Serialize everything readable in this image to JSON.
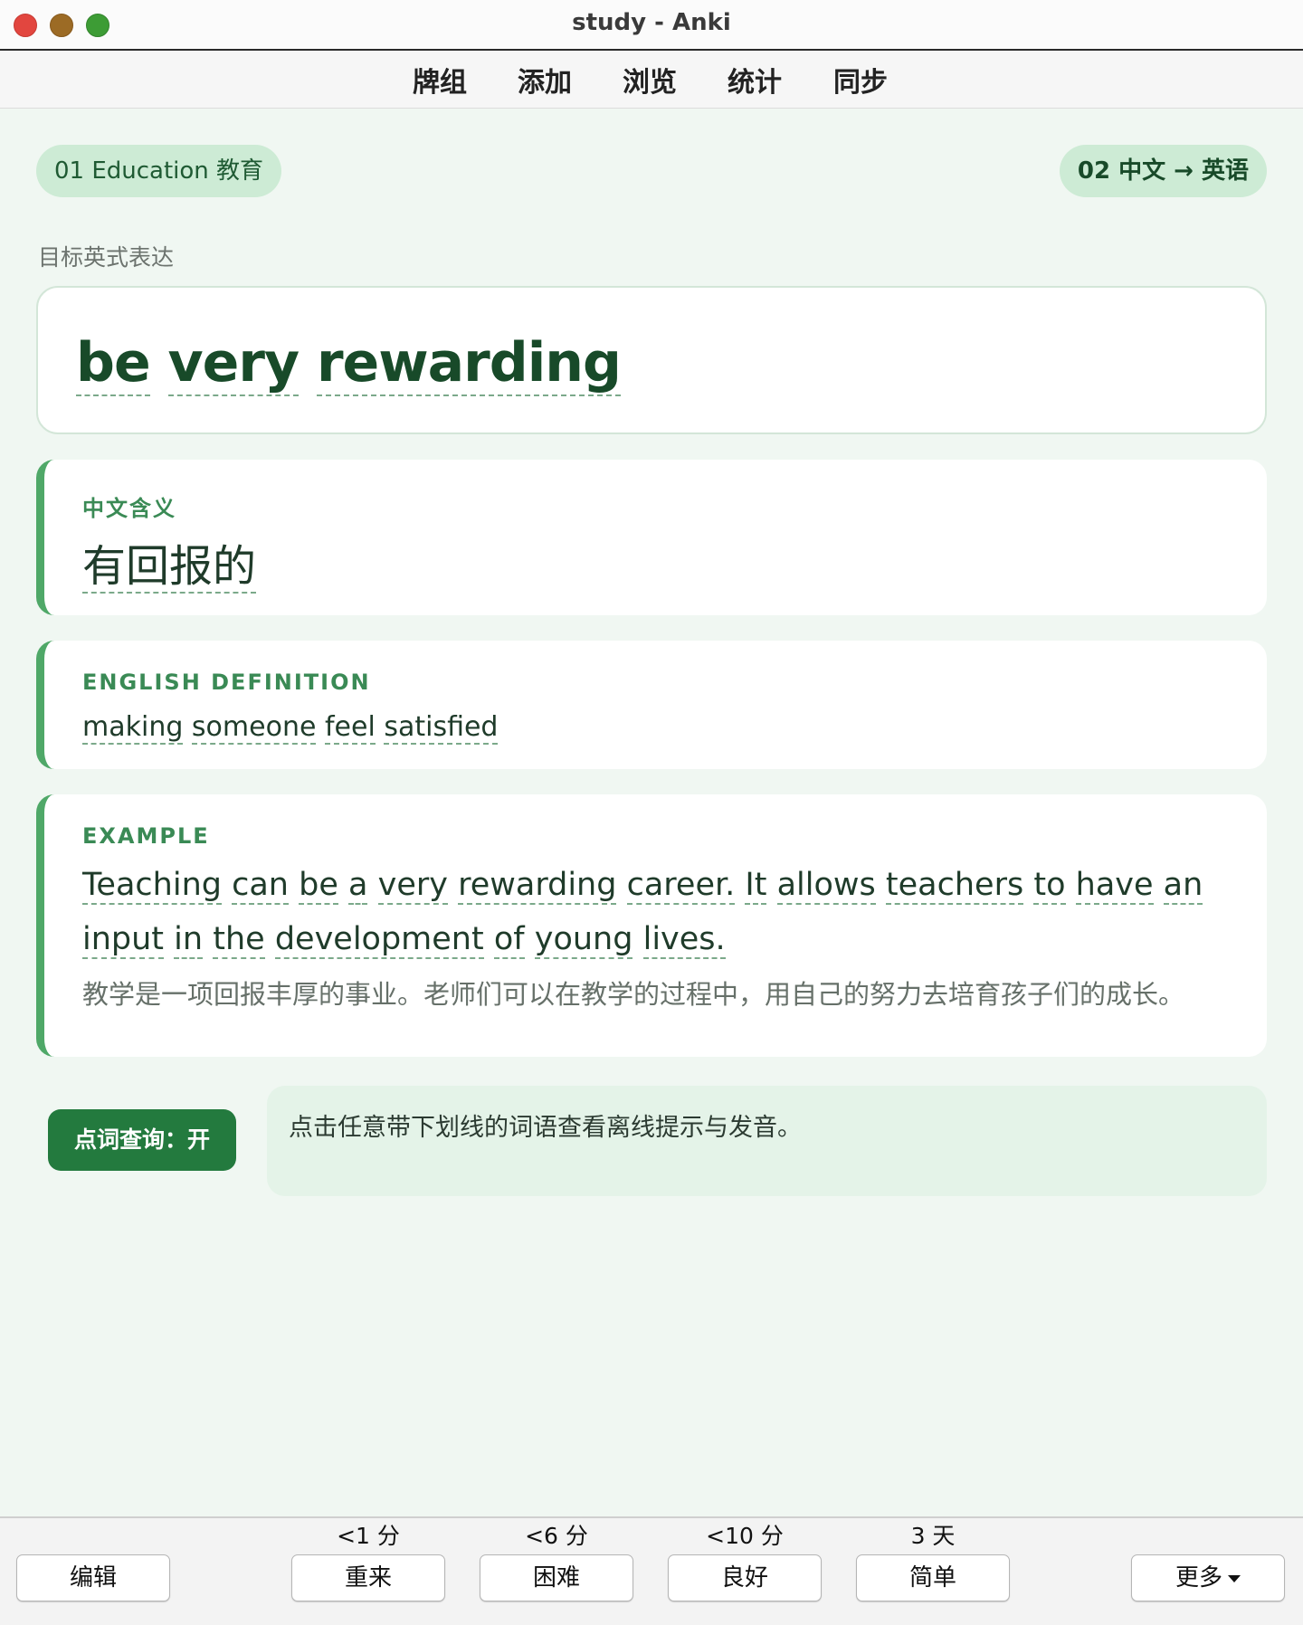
{
  "window": {
    "title": "study - Anki"
  },
  "toolbar": {
    "items": [
      "牌组",
      "添加",
      "浏览",
      "统计",
      "同步"
    ]
  },
  "card": {
    "deck_tag": "01 Education 教育",
    "direction_tag": "02 中文 → 英语",
    "target_label": "目标英式表达",
    "headword_words": [
      "be",
      "very",
      "rewarding"
    ],
    "meaning_label": "中文含义",
    "meaning": "有回报的",
    "definition_label": "ENGLISH DEFINITION",
    "definition_words": [
      "making",
      "someone",
      "feel",
      "satisfied"
    ],
    "example_label": "EXAMPLE",
    "example_en_words": [
      "Teaching",
      "can",
      "be",
      "a",
      "very",
      "rewarding",
      "career.",
      "It",
      "allows",
      "teachers",
      "to",
      "have",
      "an",
      "input",
      "in",
      "the",
      "development",
      "of",
      "young",
      "lives."
    ],
    "example_cn": "教学是一项回报丰厚的事业。老师们可以在教学的过程中，用自己的努力去培育孩子们的成长。"
  },
  "lookup": {
    "toggle_label": "点词查询：开",
    "hint": "点击任意带下划线的词语查看离线提示与发音。"
  },
  "answer_bar": {
    "edit_label": "编辑",
    "more_label": "更多",
    "buttons": [
      {
        "interval": "<1 分",
        "label": "重来"
      },
      {
        "interval": "<6 分",
        "label": "困难"
      },
      {
        "interval": "<10 分",
        "label": "良好"
      },
      {
        "interval": "3 天",
        "label": "简单"
      }
    ]
  },
  "colors": {
    "accent": "#237a3e",
    "headword": "#184a29",
    "card_border": "#4fa868",
    "background": "#f0f7f2"
  }
}
